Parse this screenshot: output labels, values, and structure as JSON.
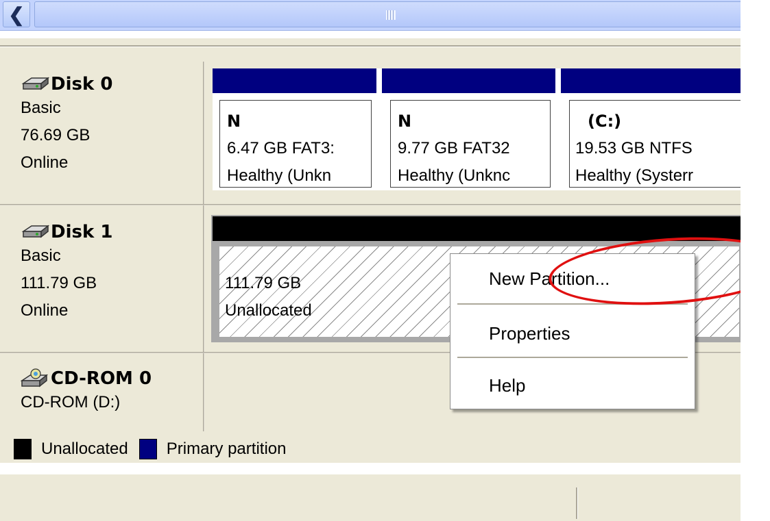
{
  "disks": [
    {
      "title": "Disk 0",
      "type": "Basic",
      "size": "76.69 GB",
      "status": "Online",
      "icon": "hard-disk-icon"
    },
    {
      "title": "Disk 1",
      "type": "Basic",
      "size": "111.79 GB",
      "status": "Online",
      "icon": "hard-disk-icon"
    },
    {
      "title": "CD-ROM 0",
      "type": "CD-ROM (D:)",
      "icon": "cdrom-icon"
    }
  ],
  "partitions": [
    {
      "name": "N",
      "size": "6.47 GB FAT3:",
      "health": "Healthy (Unkn"
    },
    {
      "name": "N",
      "size": "9.77 GB FAT32",
      "health": "Healthy (Unknc"
    },
    {
      "name": "(C:)",
      "size": "19.53 GB NTFS",
      "health": "Healthy (Systerr"
    }
  ],
  "unallocated": {
    "size": "111.79 GB",
    "label": "Unallocated"
  },
  "context_menu": {
    "items": [
      "New Partition...",
      "Properties",
      "Help"
    ]
  },
  "legend": [
    {
      "label": "Unallocated",
      "color": "#000000"
    },
    {
      "label": "Primary partition",
      "color": "#000080"
    }
  ],
  "colors": {
    "primary": "#000080",
    "unallocated": "#000000",
    "highlight_circle": "#e01010",
    "panel": "#ece9d8"
  }
}
